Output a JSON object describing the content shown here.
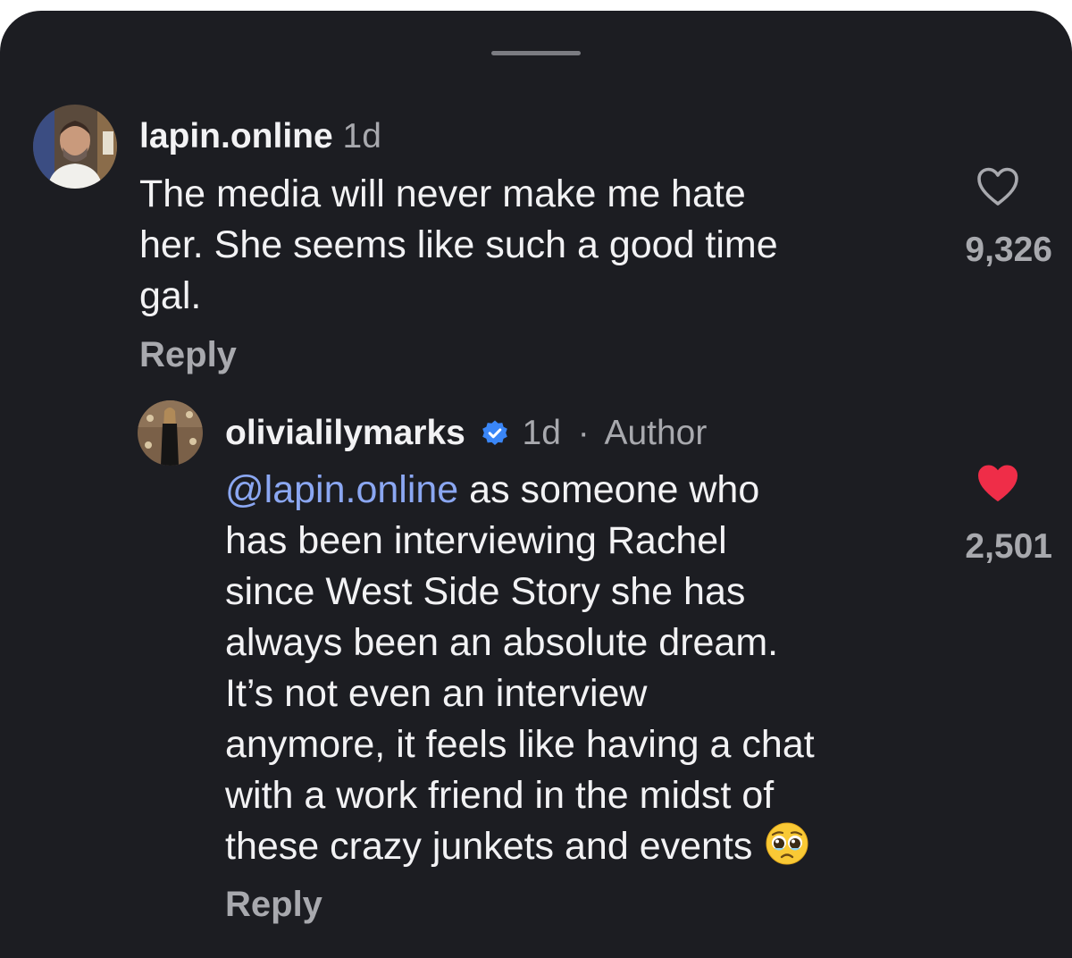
{
  "colors": {
    "background": "#1c1d22",
    "primary_text": "#f2f2f4",
    "secondary_text": "#a8a9ae",
    "mention": "#8ba7f2",
    "verified": "#3a86f7",
    "liked_heart": "#ef2d48"
  },
  "comments": [
    {
      "username": "lapin.online",
      "time": "1d",
      "lines": [
        "The media will never make me hate",
        "her. She seems like such a good time",
        "gal."
      ],
      "like_icon": "heart-outline-icon",
      "liked": false,
      "like_count": "9,326",
      "reply_label": "Reply"
    },
    {
      "username": "olivialilymarks",
      "verified": true,
      "verified_icon": "verified-badge-icon",
      "time": "1d",
      "separator": "·",
      "author_label": "Author",
      "mention": "@lapin.online",
      "lines": [
        " as someone who",
        "has been interviewing Rachel",
        "since West Side Story she has",
        "always been an absolute dream.",
        "It’s not even an interview",
        "anymore, it feels like having a chat",
        "with a work friend in the midst of",
        "these crazy junkets and events"
      ],
      "emoji": "pleading-face-emoji",
      "like_icon": "heart-filled-icon",
      "liked": true,
      "like_count": "2,501",
      "reply_label": "Reply"
    }
  ]
}
